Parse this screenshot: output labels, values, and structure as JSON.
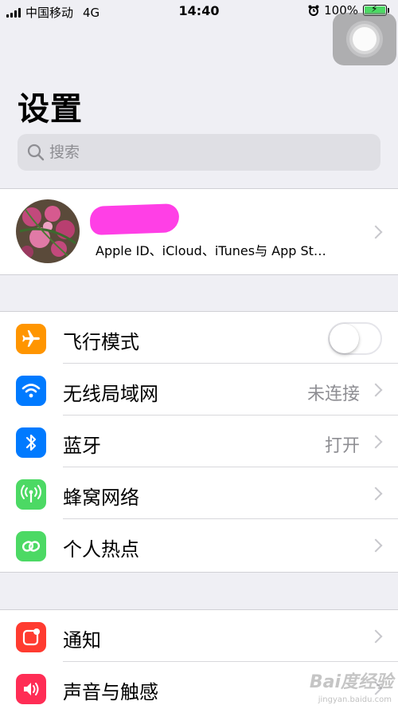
{
  "status_bar": {
    "carrier": "中国移动",
    "network": "4G",
    "time": "14:40",
    "battery_percent": "100%",
    "battery_level": 1.0,
    "icons": [
      "signal-icon",
      "alarm-icon",
      "battery-icon"
    ]
  },
  "header": {
    "title": "设置"
  },
  "search": {
    "placeholder": "搜索",
    "value": ""
  },
  "profile": {
    "subtitle": "Apple ID、iCloud、iTunes与 App St…"
  },
  "group1": {
    "items": [
      {
        "label": "飞行模式",
        "icon": "airplane-icon",
        "color": "#ff9500",
        "toggle": false
      },
      {
        "label": "无线局域网",
        "value": "未连接",
        "icon": "wifi-icon",
        "color": "#007aff"
      },
      {
        "label": "蓝牙",
        "value": "打开",
        "icon": "bluetooth-icon",
        "color": "#007aff"
      },
      {
        "label": "蜂窝网络",
        "icon": "cellular-icon",
        "color": "#4cd964"
      },
      {
        "label": "个人热点",
        "icon": "hotspot-icon",
        "color": "#4cd964"
      }
    ]
  },
  "group2": {
    "items": [
      {
        "label": "通知",
        "icon": "notifications-icon",
        "color": "#ff3b30"
      },
      {
        "label": "声音与触感",
        "icon": "sound-icon",
        "color": "#ff2d55"
      }
    ]
  },
  "watermark": {
    "text": "Bai度经验",
    "sub": "jingyan.baidu.com"
  },
  "colors": {
    "background": "#efeff4",
    "accent": "#007aff",
    "separator": "#d0d0d5"
  }
}
